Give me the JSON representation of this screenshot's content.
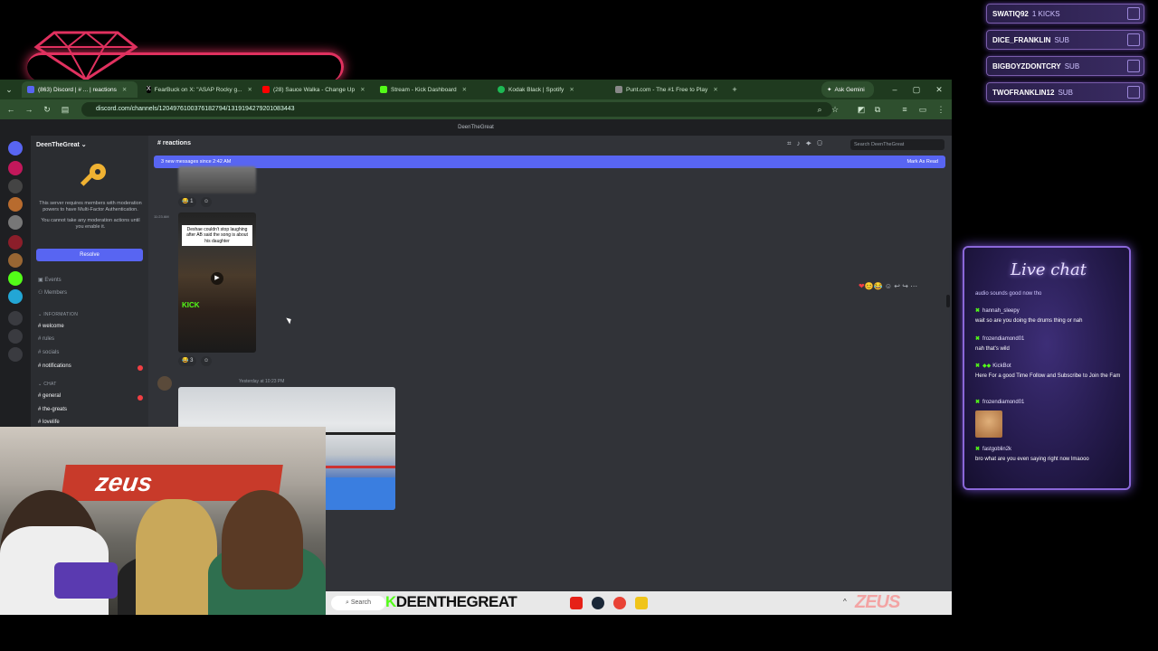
{
  "overlay": {
    "alerts": [
      {
        "user": "SWATIQ92",
        "event": "1 KICKS"
      },
      {
        "user": "DICE_FRANKLIN",
        "event": "SUB"
      },
      {
        "user": "BIGBOYZDONTCRY",
        "event": "SUB"
      },
      {
        "user": "TWOFRANKLIN12",
        "event": "SUB"
      }
    ],
    "accent_color": "#e0315f",
    "panel_color": "#7a5dab"
  },
  "browser": {
    "tabs": [
      {
        "label": "(863) Discord | # ... | reactions",
        "icon": "discord-icon",
        "active": true
      },
      {
        "label": "FearBuck on X: \"ASAP Rocky g...",
        "icon": "x-icon"
      },
      {
        "label": "(28) Sauce Walka - Change Up",
        "icon": "youtube-icon"
      },
      {
        "label": "Stream - Kick Dashboard",
        "icon": "kick-icon"
      },
      {
        "label": "Kodak Black | Spotify",
        "icon": "spotify-icon"
      },
      {
        "label": "Punt.com - The #1 Free to Play",
        "icon": "punt-icon"
      }
    ],
    "ask_gemini": "Ask Gemini",
    "url": "discord.com/channels/1204976100376182794/1319194279201083443"
  },
  "discord": {
    "window_title": "DeenTheGreat",
    "server_name": "DeenTheGreat",
    "mfa_notice": "This server requires members with moderation powers to have Multi-Factor Authentication.",
    "mfa_notice2": "You cannot take any moderation actions until you enable it.",
    "resolve_label": "Resolve",
    "nav": {
      "events": "Events",
      "members": "Members"
    },
    "categories": {
      "information": "INFORMATION",
      "chat": "CHAT"
    },
    "channels": {
      "welcome": "welcome",
      "rules": "rules",
      "socials": "socials",
      "notifications": "notifications",
      "general": "general",
      "the_greats": "the-greats",
      "lovelife": "lovelife"
    },
    "current_channel": "reactions",
    "search_placeholder": "Search DeenTheGreat",
    "new_messages_banner": "3 new messages since 2:42 AM",
    "mark_as_read": "Mark As Read",
    "msg1_reaction": "1",
    "msg2_time": "11:23 AM",
    "msg2_caption": "Deshae couldn't stop laughing after AB said the song is about his daughter",
    "msg2_kick": "KICK",
    "msg2_reaction": "3",
    "msg3_author": "",
    "msg3_time": "Yesterday at 10:23 PM"
  },
  "taskbar": {
    "search": "Search",
    "streamer": "DEENTHEGREAT",
    "sponsor": "ZEUS"
  },
  "webcam": {
    "banner": "zeus"
  },
  "live_chat": {
    "title": "Live chat",
    "top_fragment": "audio sounds good now tho",
    "messages": [
      {
        "user": "hannah_sleepy",
        "text": "wait so are you doing the drums thing or nah"
      },
      {
        "user": "frozendiamond01",
        "text": "nah that's wild"
      },
      {
        "user": "KickBot",
        "text": "Here For a good Time Follow and Subscribe to Join the Fam"
      },
      {
        "user": "frozendiamond01",
        "text": ""
      },
      {
        "user": "fastgoblin2k",
        "text": "bro what are you even saying right now lmaooo"
      }
    ]
  }
}
